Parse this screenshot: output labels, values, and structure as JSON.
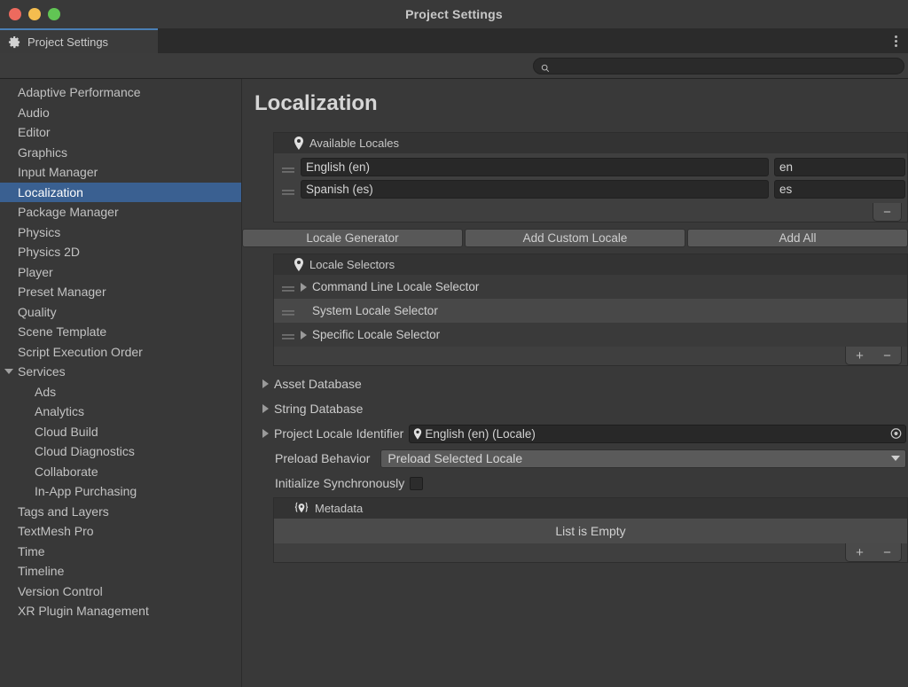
{
  "window": {
    "title": "Project Settings",
    "traffic_lights": [
      "close-red",
      "minimize-yellow",
      "zoom-green"
    ]
  },
  "tab": {
    "label": "Project Settings",
    "icon": "gear-icon",
    "accent_color": "#4a7fb5",
    "overflow_menu": "kebab-menu-icon"
  },
  "search": {
    "value": "",
    "placeholder": "",
    "icon": "search-icon"
  },
  "sidebar": {
    "items": [
      {
        "label": "Adaptive Performance",
        "level": 0,
        "selected": false,
        "expandable": false
      },
      {
        "label": "Audio",
        "level": 0,
        "selected": false,
        "expandable": false
      },
      {
        "label": "Editor",
        "level": 0,
        "selected": false,
        "expandable": false
      },
      {
        "label": "Graphics",
        "level": 0,
        "selected": false,
        "expandable": false
      },
      {
        "label": "Input Manager",
        "level": 0,
        "selected": false,
        "expandable": false
      },
      {
        "label": "Localization",
        "level": 0,
        "selected": true,
        "expandable": false
      },
      {
        "label": "Package Manager",
        "level": 0,
        "selected": false,
        "expandable": false
      },
      {
        "label": "Physics",
        "level": 0,
        "selected": false,
        "expandable": false
      },
      {
        "label": "Physics 2D",
        "level": 0,
        "selected": false,
        "expandable": false
      },
      {
        "label": "Player",
        "level": 0,
        "selected": false,
        "expandable": false
      },
      {
        "label": "Preset Manager",
        "level": 0,
        "selected": false,
        "expandable": false
      },
      {
        "label": "Quality",
        "level": 0,
        "selected": false,
        "expandable": false
      },
      {
        "label": "Scene Template",
        "level": 0,
        "selected": false,
        "expandable": false
      },
      {
        "label": "Script Execution Order",
        "level": 0,
        "selected": false,
        "expandable": false
      },
      {
        "label": "Services",
        "level": 0,
        "selected": false,
        "expandable": true,
        "expanded": true
      },
      {
        "label": "Ads",
        "level": 1,
        "selected": false,
        "expandable": false
      },
      {
        "label": "Analytics",
        "level": 1,
        "selected": false,
        "expandable": false
      },
      {
        "label": "Cloud Build",
        "level": 1,
        "selected": false,
        "expandable": false
      },
      {
        "label": "Cloud Diagnostics",
        "level": 1,
        "selected": false,
        "expandable": false
      },
      {
        "label": "Collaborate",
        "level": 1,
        "selected": false,
        "expandable": false
      },
      {
        "label": "In-App Purchasing",
        "level": 1,
        "selected": false,
        "expandable": false
      },
      {
        "label": "Tags and Layers",
        "level": 0,
        "selected": false,
        "expandable": false
      },
      {
        "label": "TextMesh Pro",
        "level": 0,
        "selected": false,
        "expandable": false
      },
      {
        "label": "Time",
        "level": 0,
        "selected": false,
        "expandable": false
      },
      {
        "label": "Timeline",
        "level": 0,
        "selected": false,
        "expandable": false
      },
      {
        "label": "Version Control",
        "level": 0,
        "selected": false,
        "expandable": false
      },
      {
        "label": "XR Plugin Management",
        "level": 0,
        "selected": false,
        "expandable": false
      }
    ],
    "selected_color": "#3a6091"
  },
  "main": {
    "page_title": "Localization",
    "available_locales": {
      "header": "Available Locales",
      "header_icon": "locale-pin-icon",
      "rows": [
        {
          "name": "English (en)",
          "code": "en"
        },
        {
          "name": "Spanish (es)",
          "code": "es"
        }
      ],
      "footer_buttons": [
        {
          "label": "−",
          "name": "remove-locale-button"
        }
      ]
    },
    "locale_buttons": [
      {
        "label": "Locale Generator",
        "name": "locale-generator-button"
      },
      {
        "label": "Add Custom Locale",
        "name": "add-custom-locale-button"
      },
      {
        "label": "Add All",
        "name": "add-all-button"
      }
    ],
    "locale_selectors": {
      "header": "Locale Selectors",
      "header_icon": "locale-pin-icon",
      "rows": [
        {
          "label": "Command Line Locale Selector",
          "expandable": true
        },
        {
          "label": "System Locale Selector",
          "expandable": false
        },
        {
          "label": "Specific Locale Selector",
          "expandable": true
        }
      ],
      "footer_buttons": [
        {
          "label": "+",
          "name": "add-selector-button"
        },
        {
          "label": "−",
          "name": "remove-selector-button"
        }
      ]
    },
    "foldouts": [
      {
        "label": "Asset Database",
        "expanded": false
      },
      {
        "label": "String Database",
        "expanded": false
      }
    ],
    "project_locale_identifier": {
      "label": "Project Locale Identifier",
      "value": "English (en) (Locale)",
      "value_icon": "locale-pin-icon",
      "picker_icon": "object-picker-icon",
      "expanded": false
    },
    "preload_behavior": {
      "label": "Preload Behavior",
      "value": "Preload Selected Locale"
    },
    "initialize_synchronously": {
      "label": "Initialize Synchronously",
      "checked": false
    },
    "metadata": {
      "header": "Metadata",
      "header_icon": "metadata-icon",
      "empty_text": "List is Empty",
      "footer_buttons": [
        {
          "label": "+",
          "name": "add-metadata-button"
        },
        {
          "label": "−",
          "name": "remove-metadata-button"
        }
      ]
    }
  }
}
